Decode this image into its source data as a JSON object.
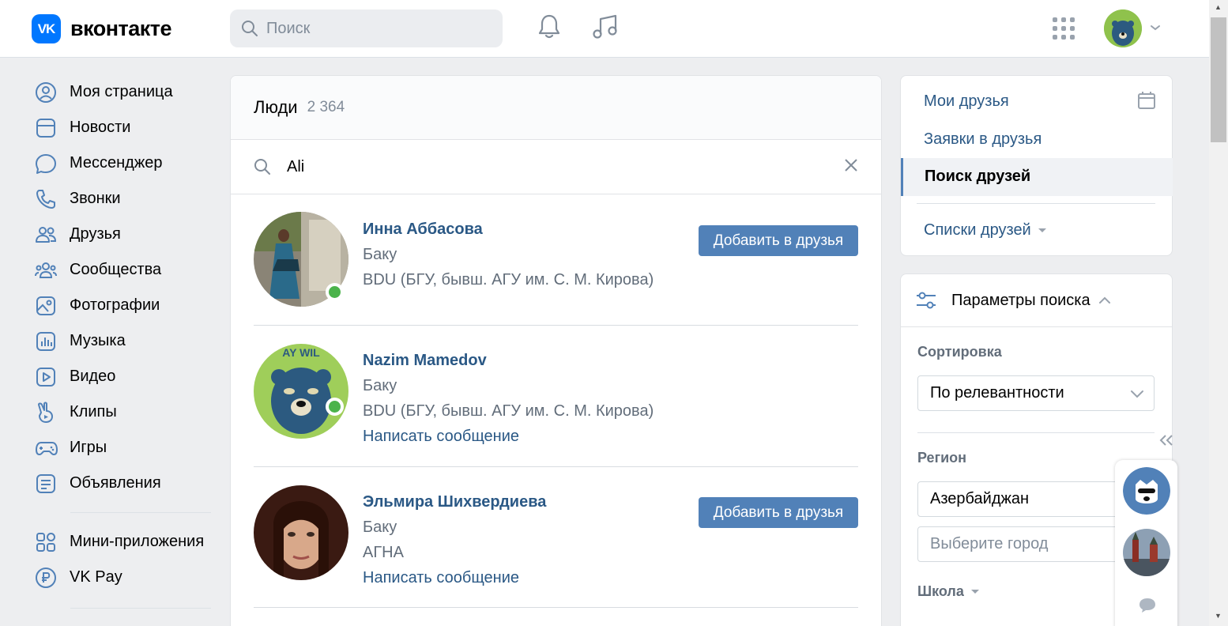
{
  "header": {
    "logo_mark": "VK",
    "logo_text": "вконтакте",
    "search_placeholder": "Поиск"
  },
  "nav": {
    "items": [
      {
        "label": "Моя страница",
        "icon": "user-circle-icon"
      },
      {
        "label": "Новости",
        "icon": "news-icon"
      },
      {
        "label": "Мессенджер",
        "icon": "message-icon"
      },
      {
        "label": "Звонки",
        "icon": "phone-icon"
      },
      {
        "label": "Друзья",
        "icon": "friends-icon"
      },
      {
        "label": "Сообщества",
        "icon": "communities-icon"
      },
      {
        "label": "Фотографии",
        "icon": "photo-icon"
      },
      {
        "label": "Музыка",
        "icon": "music-icon"
      },
      {
        "label": "Видео",
        "icon": "video-icon"
      },
      {
        "label": "Клипы",
        "icon": "clips-icon"
      },
      {
        "label": "Игры",
        "icon": "gamepad-icon"
      },
      {
        "label": "Объявления",
        "icon": "ads-icon"
      }
    ],
    "extra_items": [
      {
        "label": "Мини-приложения",
        "icon": "apps-icon"
      },
      {
        "label": "VK Pay",
        "icon": "vkpay-icon"
      }
    ]
  },
  "main": {
    "title": "Люди",
    "count": "2 364",
    "query": "Ali",
    "people": [
      {
        "name": "Инна Аббасова",
        "city": "Баку",
        "edu": "BDU (БГУ, бывш. АГУ им. С. М. Кирова)",
        "message": "",
        "online": true,
        "action": "Добавить в друзья"
      },
      {
        "name": "Nazim Mamedov",
        "city": "Баку",
        "edu": "BDU (БГУ, бывш. АГУ им. С. М. Кирова)",
        "message": "Написать сообщение",
        "online": true,
        "action": ""
      },
      {
        "name": "Эльмира Шихвердиева",
        "city": "Баку",
        "edu": "АГНА",
        "message": "Написать сообщение",
        "online": false,
        "action": "Добавить в друзья"
      }
    ]
  },
  "right_menu": {
    "my_friends": "Мои друзья",
    "requests": "Заявки в друзья",
    "search": "Поиск друзей",
    "lists": "Списки друзей"
  },
  "params": {
    "title": "Параметры поиска",
    "sort_label": "Сортировка",
    "sort_value": "По релевантности",
    "region_label": "Регион",
    "country_value": "Азербайджан",
    "city_placeholder": "Выберите город",
    "school_label": "Школа"
  },
  "colors": {
    "brand": "#0077ff",
    "link": "#2a5885",
    "button": "#5181b8",
    "online": "#4bb34b"
  }
}
